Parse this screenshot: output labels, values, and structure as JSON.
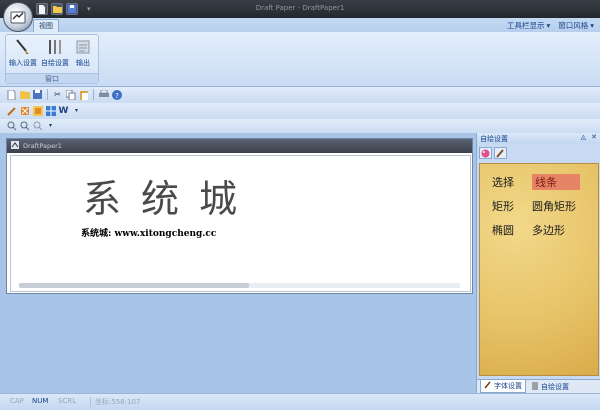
{
  "window": {
    "title": "Draft Paper - DraftPaper1"
  },
  "ribbon": {
    "tab_view": "视图",
    "toolbar_display": "工具栏显示",
    "window_style": "窗口风格",
    "group_label": "窗口",
    "buttons": [
      {
        "label": "输入设置",
        "icon": "brush-icon"
      },
      {
        "label": "自绘设置",
        "icon": "pencils-icon"
      },
      {
        "label": "输出",
        "icon": "output-icon"
      }
    ]
  },
  "document": {
    "tab_title": "DraftPaper1",
    "handwriting": "系统城",
    "caption": "系统城: www.xitongcheng.cc"
  },
  "panel": {
    "title": "自绘设置",
    "shapes": [
      "选择",
      "线条",
      "矩形",
      "圆角矩形",
      "椭圆",
      "多边形"
    ],
    "selected": "线条",
    "tabs": [
      "字体设置",
      "自绘设置"
    ]
  },
  "status": {
    "cap": "CAP",
    "num": "NUM",
    "scrl": "SCRL",
    "coord": "坐标:558:107"
  },
  "colors": {
    "accent": "#15428b",
    "selection": "#e58565",
    "paper": "#e6c165"
  }
}
